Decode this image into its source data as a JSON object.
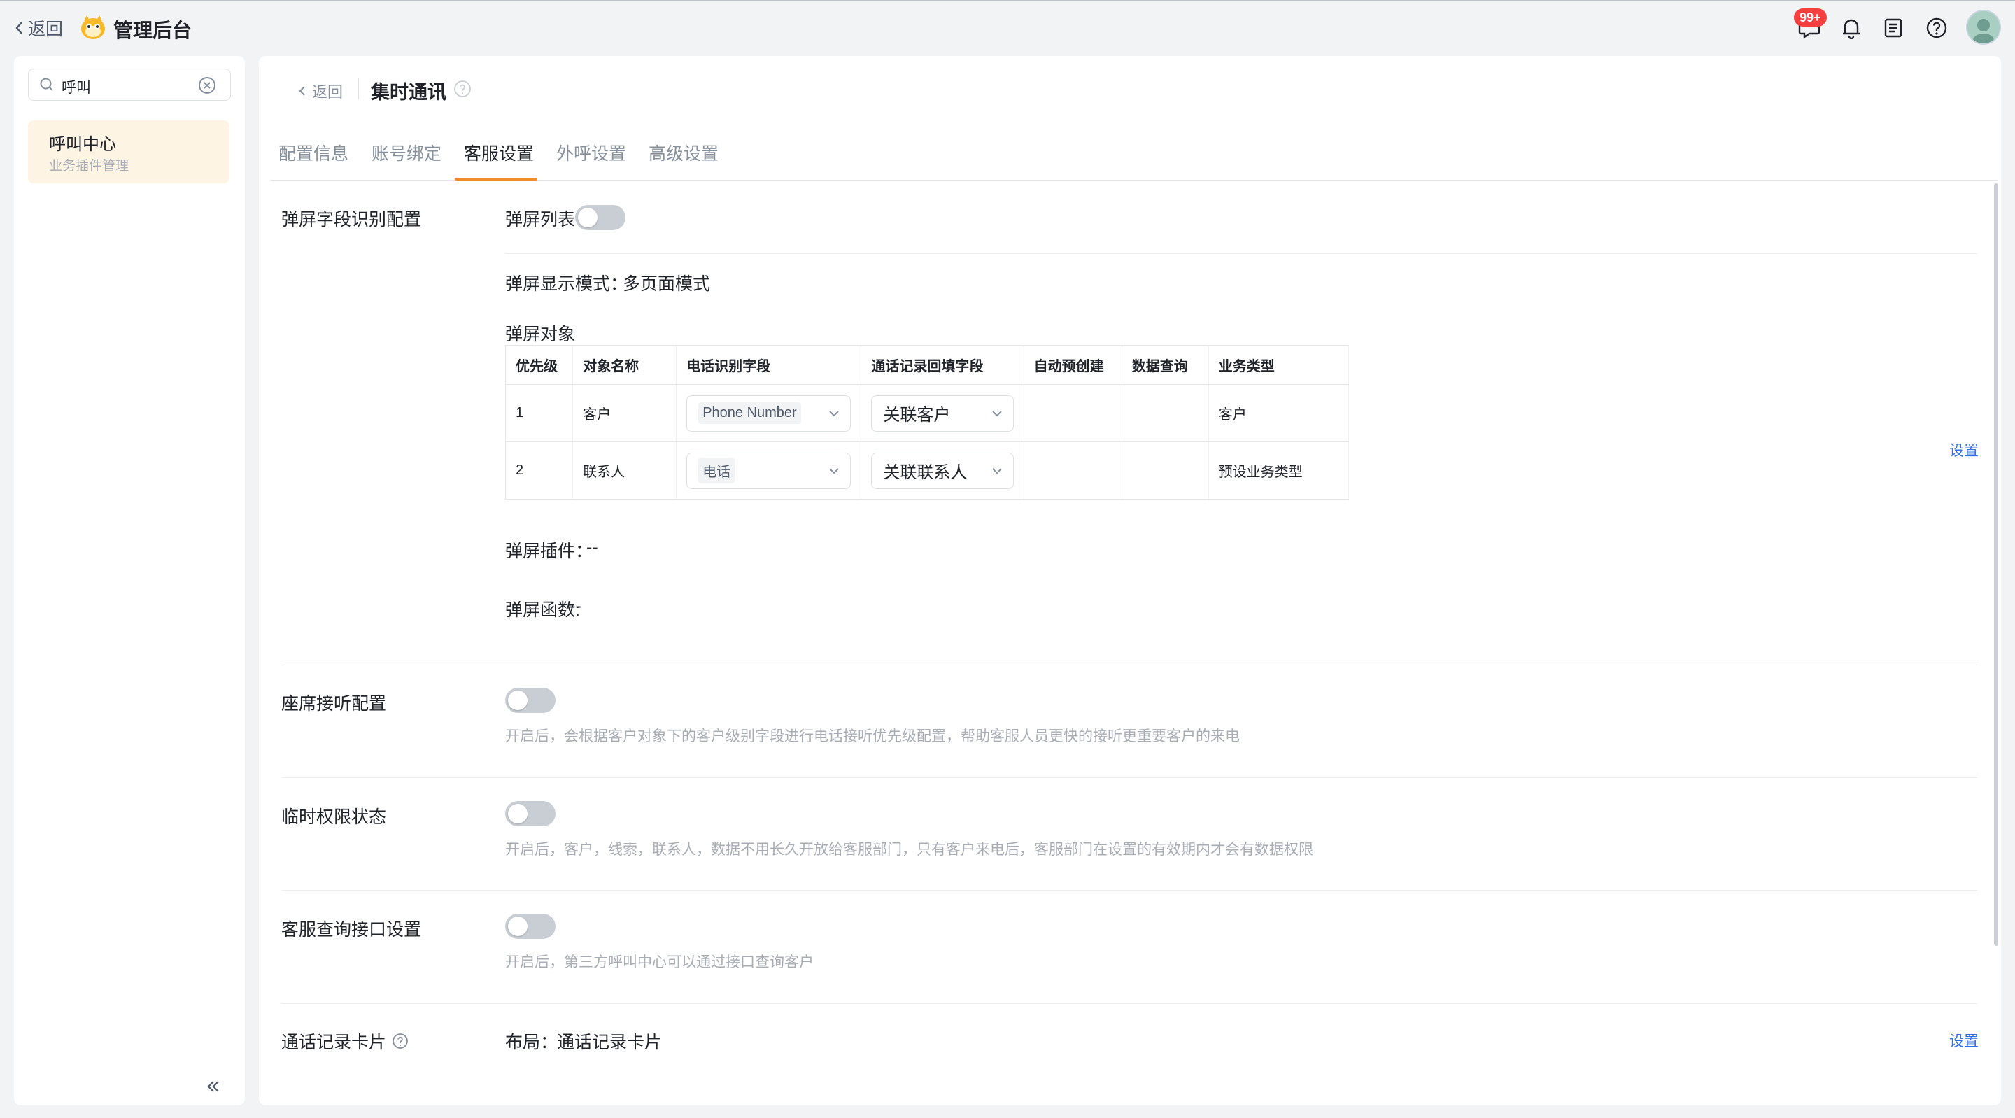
{
  "topbar": {
    "back_label": "返回",
    "app_title": "管理后台",
    "badge": "99+"
  },
  "sidebar": {
    "search_value": "呼叫",
    "item": {
      "label": "呼叫中心",
      "sub": "业务插件管理"
    }
  },
  "header": {
    "back_label": "返回",
    "title": "集时通讯"
  },
  "tabs": [
    {
      "label": "配置信息"
    },
    {
      "label": "账号绑定"
    },
    {
      "label": "客服设置",
      "active": true
    },
    {
      "label": "外呼设置"
    },
    {
      "label": "高级设置"
    }
  ],
  "sections": {
    "popup": {
      "label": "弹屏字段识别配置",
      "list_label": "弹屏列表",
      "list_toggle": false,
      "mode_label": "弹屏显示模式：",
      "mode_value": "多页面模式",
      "object_label": "弹屏对象",
      "setting_link": "设置",
      "plugin_label": "弹屏插件：",
      "plugin_value": "--",
      "function_label": "弹屏函数:",
      "function_value": "--"
    },
    "seat": {
      "label": "座席接听配置",
      "toggle": false,
      "hint": "开启后，会根据客户对象下的客户级别字段进行电话接听优先级配置，帮助客服人员更快的接听更重要客户的来电"
    },
    "temp": {
      "label": "临时权限状态",
      "toggle": false,
      "hint": "开启后，客户，线索，联系人，数据不用长久开放给客服部门，只有客户来电后，客服部门在设置的有效期内才会有数据权限"
    },
    "api": {
      "label": "客服查询接口设置",
      "toggle": false,
      "hint": "开启后，第三方呼叫中心可以通过接口查询客户"
    },
    "card": {
      "label": "通话记录卡片",
      "layout_label": "布局：",
      "layout_value": "通话记录卡片",
      "setting_link": "设置"
    }
  },
  "table": {
    "headers": [
      "优先级",
      "对象名称",
      "电话识别字段",
      "通话记录回填字段",
      "自动预创建",
      "数据查询",
      "业务类型"
    ],
    "rows": [
      {
        "priority": "1",
        "object": "客户",
        "phone_field": "Phone Number",
        "fill_field": "关联客户",
        "auto_create": "",
        "query": "",
        "biz_type": "客户"
      },
      {
        "priority": "2",
        "object": "联系人",
        "phone_field": "电话",
        "fill_field": "关联联系人",
        "auto_create": "",
        "query": "",
        "biz_type": "预设业务类型"
      }
    ]
  },
  "colors": {
    "accent": "#f08c2a",
    "link": "#2f6fe4",
    "badge": "#f53f3f",
    "sidebar_active": "#fdf4e4"
  }
}
